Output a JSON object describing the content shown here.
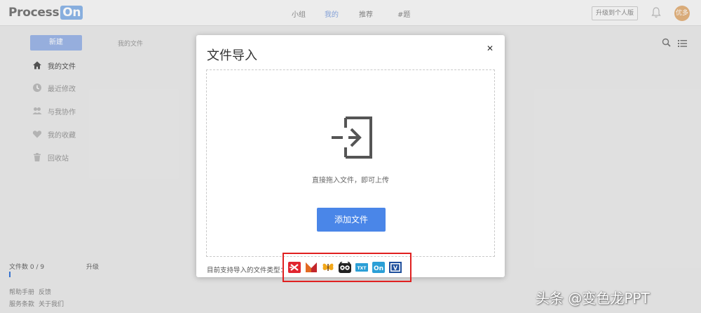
{
  "app": {
    "logo_text": "Process",
    "logo_badge": "On",
    "nav": [
      "小组",
      "我的",
      "推荐",
      "#题"
    ],
    "active_nav_index": 1,
    "upgrade_button": "升级到个人版",
    "avatar_text": "优多"
  },
  "sidebar": {
    "new_button": "新建",
    "breadcrumb": "我的文件",
    "items": [
      {
        "label": "我的文件",
        "icon": "home-icon"
      },
      {
        "label": "最近修改",
        "icon": "clock-icon"
      },
      {
        "label": "与我协作",
        "icon": "users-icon"
      },
      {
        "label": "我的收藏",
        "icon": "heart-icon"
      },
      {
        "label": "回收站",
        "icon": "trash-icon"
      }
    ],
    "file_count": "文件数 0 / 9",
    "file_progress": 0.0,
    "upgrade_link": "升级",
    "footer_links": [
      "帮助手册",
      "反馈",
      "服务条款",
      "关于我们"
    ]
  },
  "modal": {
    "title": "文件导入",
    "close_icon": "close-icon",
    "drop_text": "直接拖入文件，即可上传",
    "add_button": "添加文件",
    "supported_label": "目前支持导入的文件类型：",
    "file_types": [
      "xmind",
      "mindmanager",
      "freemind",
      "omnigraffle",
      "txt",
      "processon",
      "visio"
    ]
  },
  "watermark": "头条 @变色龙PPT",
  "colors": {
    "accent": "#4a86e8",
    "highlight_box": "#e02020"
  }
}
